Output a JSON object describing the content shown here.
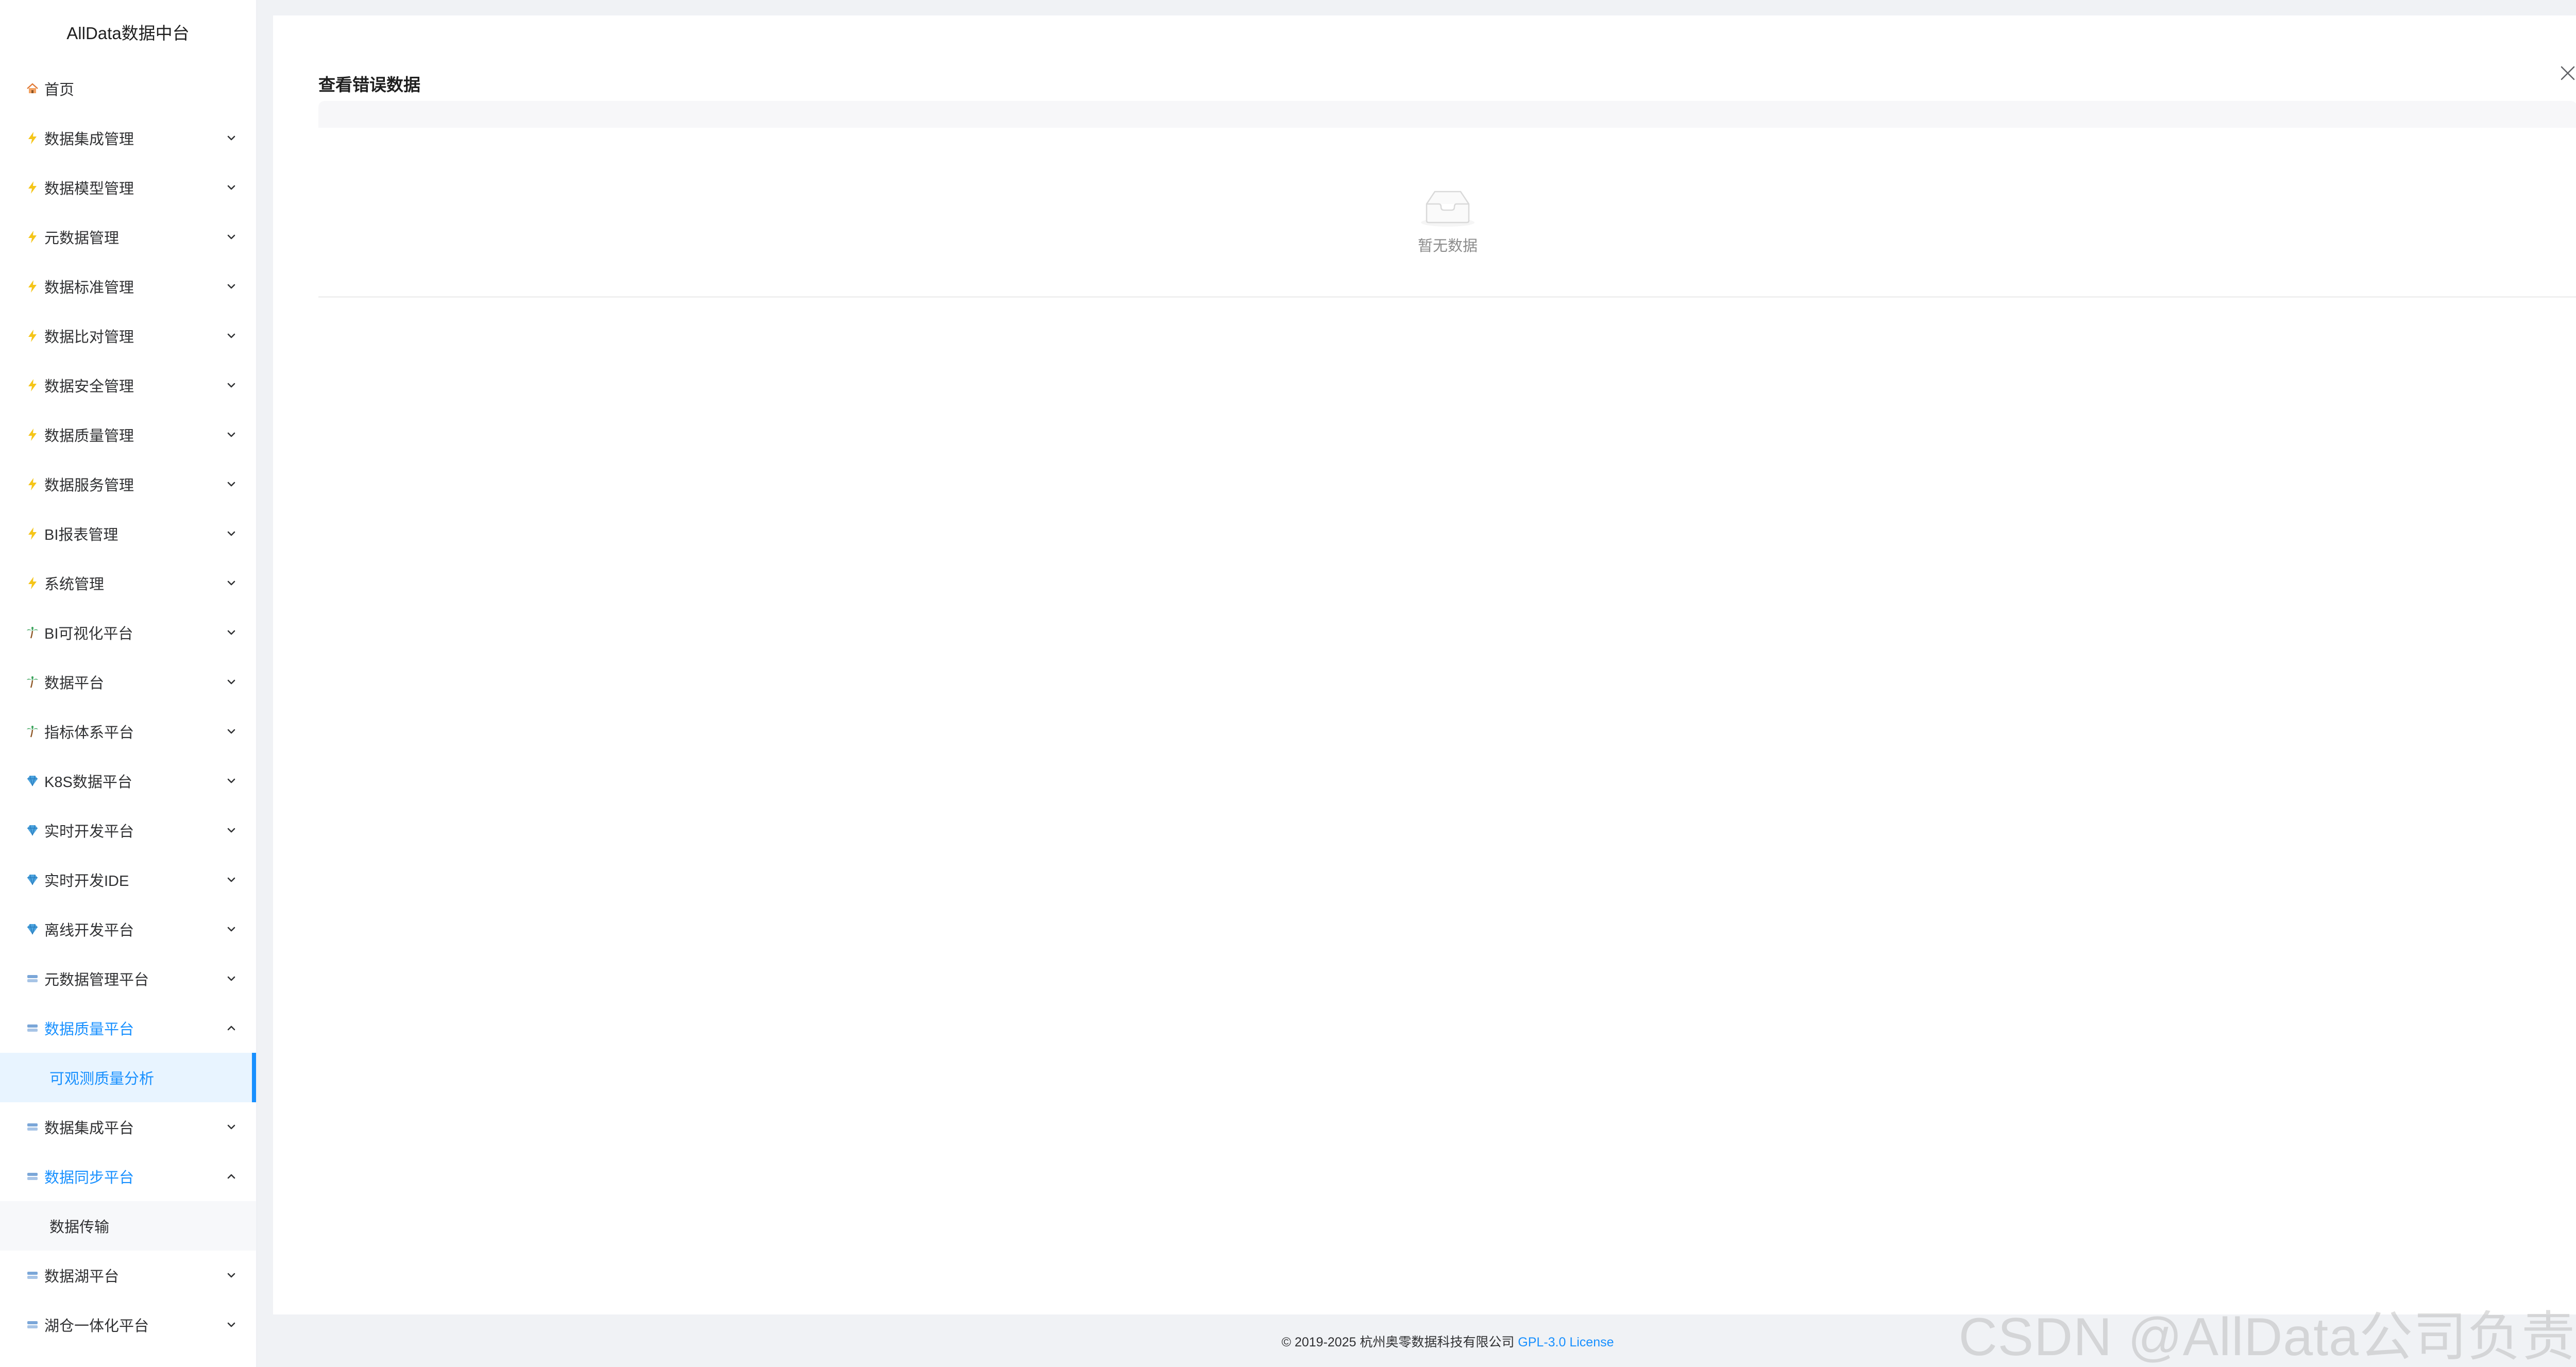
{
  "app": {
    "title": "AllData数据中台"
  },
  "sidebar": {
    "items": [
      {
        "label": "首页",
        "icon": "house-icon",
        "chevron": "none"
      },
      {
        "label": "数据集成管理",
        "icon": "lightning-icon",
        "chevron": "down"
      },
      {
        "label": "数据模型管理",
        "icon": "lightning-icon",
        "chevron": "down"
      },
      {
        "label": "元数据管理",
        "icon": "lightning-icon",
        "chevron": "down"
      },
      {
        "label": "数据标准管理",
        "icon": "lightning-icon",
        "chevron": "down"
      },
      {
        "label": "数据比对管理",
        "icon": "lightning-icon",
        "chevron": "down"
      },
      {
        "label": "数据安全管理",
        "icon": "lightning-icon",
        "chevron": "down"
      },
      {
        "label": "数据质量管理",
        "icon": "lightning-icon",
        "chevron": "down"
      },
      {
        "label": "数据服务管理",
        "icon": "lightning-icon",
        "chevron": "down"
      },
      {
        "label": "BI报表管理",
        "icon": "lightning-icon",
        "chevron": "down"
      },
      {
        "label": "系统管理",
        "icon": "lightning-icon",
        "chevron": "down"
      },
      {
        "label": "BI可视化平台",
        "icon": "palm-tree-icon",
        "chevron": "down"
      },
      {
        "label": "数据平台",
        "icon": "palm-tree-icon",
        "chevron": "down"
      },
      {
        "label": "指标体系平台",
        "icon": "palm-tree-icon",
        "chevron": "down"
      },
      {
        "label": "K8S数据平台",
        "icon": "gem-icon",
        "chevron": "down"
      },
      {
        "label": "实时开发平台",
        "icon": "gem-icon",
        "chevron": "down"
      },
      {
        "label": "实时开发IDE",
        "icon": "gem-icon",
        "chevron": "down"
      },
      {
        "label": "离线开发平台",
        "icon": "gem-icon",
        "chevron": "down"
      },
      {
        "label": "元数据管理平台",
        "icon": "cloud-icon",
        "chevron": "down"
      },
      {
        "label": "数据质量平台",
        "icon": "cloud-icon",
        "chevron": "up",
        "open": true,
        "children": [
          {
            "label": "可观测质量分析",
            "active": true
          }
        ]
      },
      {
        "label": "数据集成平台",
        "icon": "cloud-icon",
        "chevron": "down"
      },
      {
        "label": "数据同步平台",
        "icon": "cloud-icon",
        "chevron": "up",
        "open": true,
        "children": [
          {
            "label": "数据传输",
            "active": false
          }
        ]
      },
      {
        "label": "数据湖平台",
        "icon": "cloud-icon",
        "chevron": "down"
      },
      {
        "label": "湖仓一体化平台",
        "icon": "cloud-icon",
        "chevron": "down"
      }
    ]
  },
  "dialog": {
    "title": "查看错误数据",
    "empty_text": "暂无数据",
    "close_icon": "close-icon"
  },
  "footer": {
    "copyright": "© 2019-2025 杭州奥零数据科技有限公司",
    "license": "GPL-3.0 License"
  },
  "watermark": {
    "text": "CSDN @AllData公司负责人"
  },
  "colors": {
    "accent": "#1890ff",
    "sidebar_bg": "#ffffff",
    "page_bg": "#f0f2f5",
    "active_submenu_bg": "#e8f4ff"
  }
}
